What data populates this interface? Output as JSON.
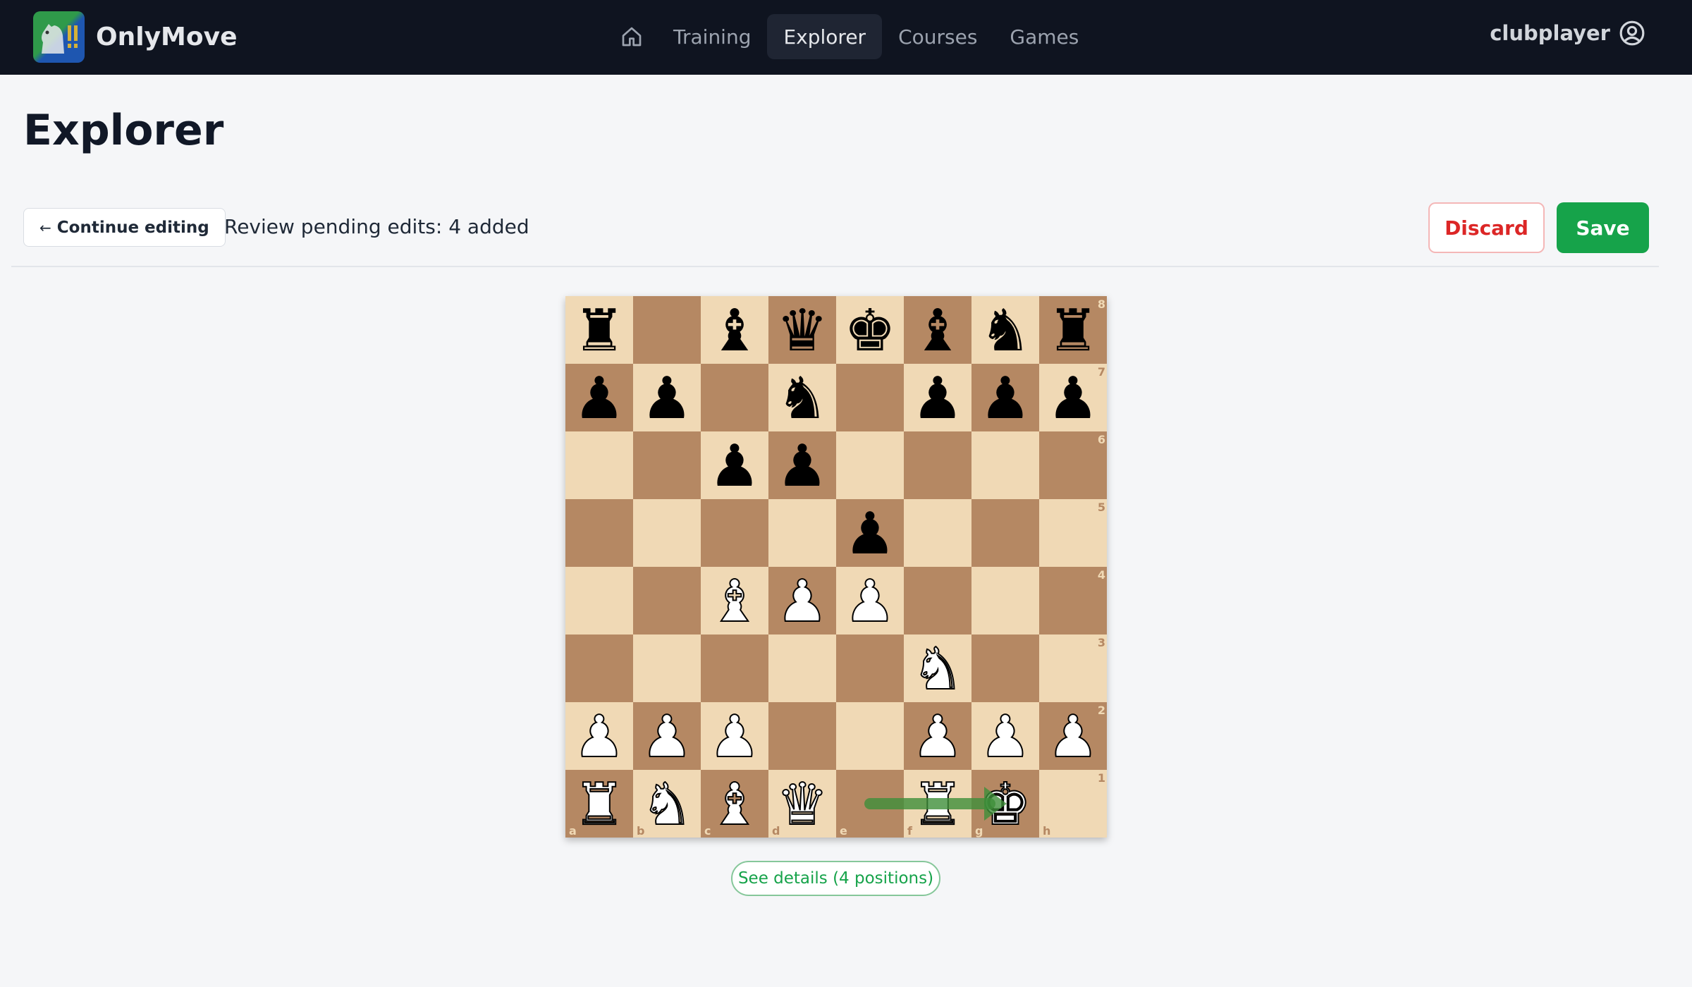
{
  "app": {
    "name": "OnlyMove"
  },
  "nav": {
    "items": [
      {
        "label": "Training",
        "active": false
      },
      {
        "label": "Explorer",
        "active": true
      },
      {
        "label": "Courses",
        "active": false
      },
      {
        "label": "Games",
        "active": false
      }
    ]
  },
  "user": {
    "name": "clubplayer"
  },
  "page": {
    "title": "Explorer"
  },
  "toolbar": {
    "continue_label": "Continue editing",
    "continue_arrow": "←",
    "review_text": "Review pending edits: 4 added",
    "discard_label": "Discard",
    "save_label": "Save"
  },
  "board": {
    "ranks": [
      "8",
      "7",
      "6",
      "5",
      "4",
      "3",
      "2",
      "1"
    ],
    "files": [
      "a",
      "b",
      "c",
      "d",
      "e",
      "f",
      "g",
      "h"
    ],
    "position": [
      [
        "br",
        "",
        "bb",
        "bq",
        "bk",
        "bb",
        "bn",
        "br"
      ],
      [
        "bp",
        "bp",
        "",
        "bn",
        "",
        "bp",
        "bp",
        "bp"
      ],
      [
        "",
        "",
        "bp",
        "bp",
        "",
        "",
        "",
        ""
      ],
      [
        "",
        "",
        "",
        "",
        "bp",
        "",
        "",
        ""
      ],
      [
        "",
        "",
        "wb",
        "wp",
        "wp",
        "",
        "",
        ""
      ],
      [
        "",
        "",
        "",
        "",
        "",
        "wn",
        "",
        ""
      ],
      [
        "wp",
        "wp",
        "wp",
        "",
        "",
        "wp",
        "wp",
        "wp"
      ],
      [
        "wr",
        "wn",
        "wb",
        "wq",
        "",
        "wr",
        "wk",
        ""
      ]
    ],
    "arrow": {
      "from": "e1",
      "to": "g1",
      "color": "#3f8f3a"
    },
    "colors": {
      "light": "#f0d9b5",
      "dark": "#b58863"
    }
  },
  "details": {
    "label": "See details (4 positions)"
  },
  "colors": {
    "accent": "#16a34a",
    "danger": "#dc2626",
    "nav_bg": "#0f1420"
  }
}
